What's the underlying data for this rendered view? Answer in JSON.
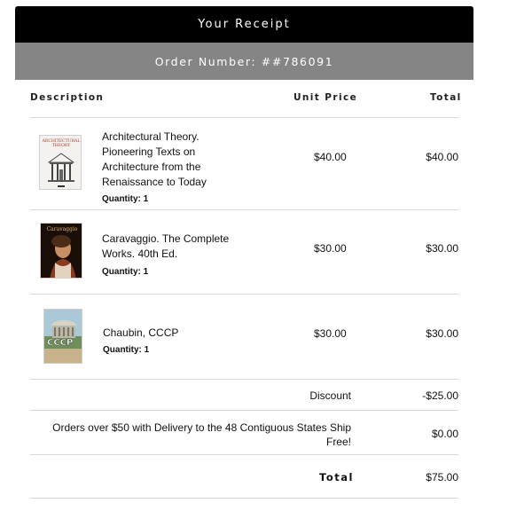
{
  "header": {
    "title": "Your Receipt"
  },
  "order": {
    "label": "Order Number: ##786091"
  },
  "columns": {
    "description": "Description",
    "unit_price": "Unit Price",
    "total": "Total"
  },
  "items": [
    {
      "title_lines": [
        "Architectural Theory.",
        "Pioneering Texts on",
        "Architecture from the",
        "Renaissance to Today"
      ],
      "quantity": "Quantity: 1",
      "unit_price": "$40.00",
      "total": "$40.00",
      "cover_text": [
        "ARCHITECTURAL",
        "THEORY"
      ]
    },
    {
      "title_lines": [
        "Caravaggio. The Complete",
        "Works. 40th Ed."
      ],
      "quantity": "Quantity: 1",
      "unit_price": "$30.00",
      "total": "$30.00",
      "cover_text": [
        "Caravaggio"
      ]
    },
    {
      "title_lines": [
        "Chaubin, CCCP"
      ],
      "quantity": "Quantity: 1",
      "unit_price": "$30.00",
      "total": "$30.00",
      "cover_text": [
        "CCCP"
      ]
    }
  ],
  "summary": {
    "discount_label": "Discount",
    "discount_value": "-$25.00",
    "shipping_label_1": "Orders over $50 with Delivery to the 48 Contiguous States Ship",
    "shipping_label_2": "Free!",
    "shipping_value": "$0.00",
    "total_label": "Total",
    "total_value": "$75.00"
  }
}
